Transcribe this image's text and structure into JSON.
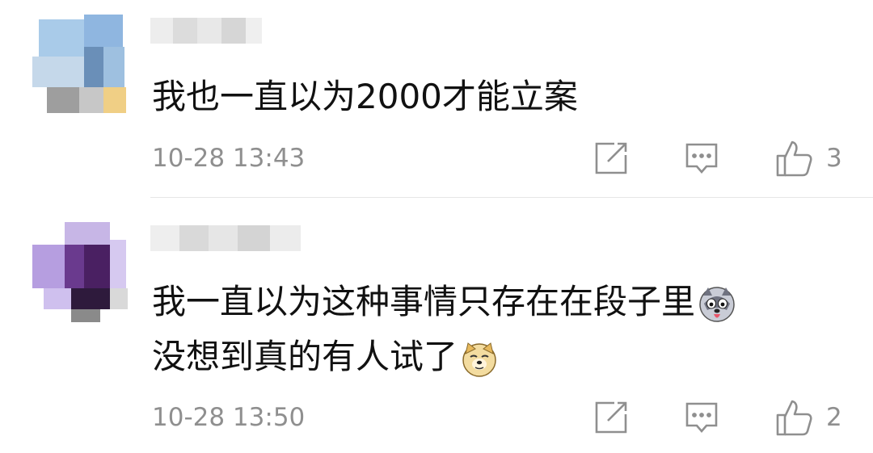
{
  "comments": [
    {
      "username": "",
      "text_lines": [
        "我也一直以为2000才能立案"
      ],
      "emoji": [],
      "time": "10-28 13:43",
      "like_count": "3"
    },
    {
      "username": "",
      "text_lines": [
        "我一直以为这种事情只存在在段子里",
        "没想到真的有人试了"
      ],
      "emoji": [
        "husky-emoji",
        "doge-emoji"
      ],
      "time": "10-28 13:50",
      "like_count": "2"
    }
  ],
  "icons": {
    "share": "share-icon",
    "reply": "comment-icon",
    "like": "thumbs-up-icon"
  },
  "colors": {
    "text": "#111111",
    "meta": "#8f8f8f",
    "divider": "#e6e6e6"
  }
}
